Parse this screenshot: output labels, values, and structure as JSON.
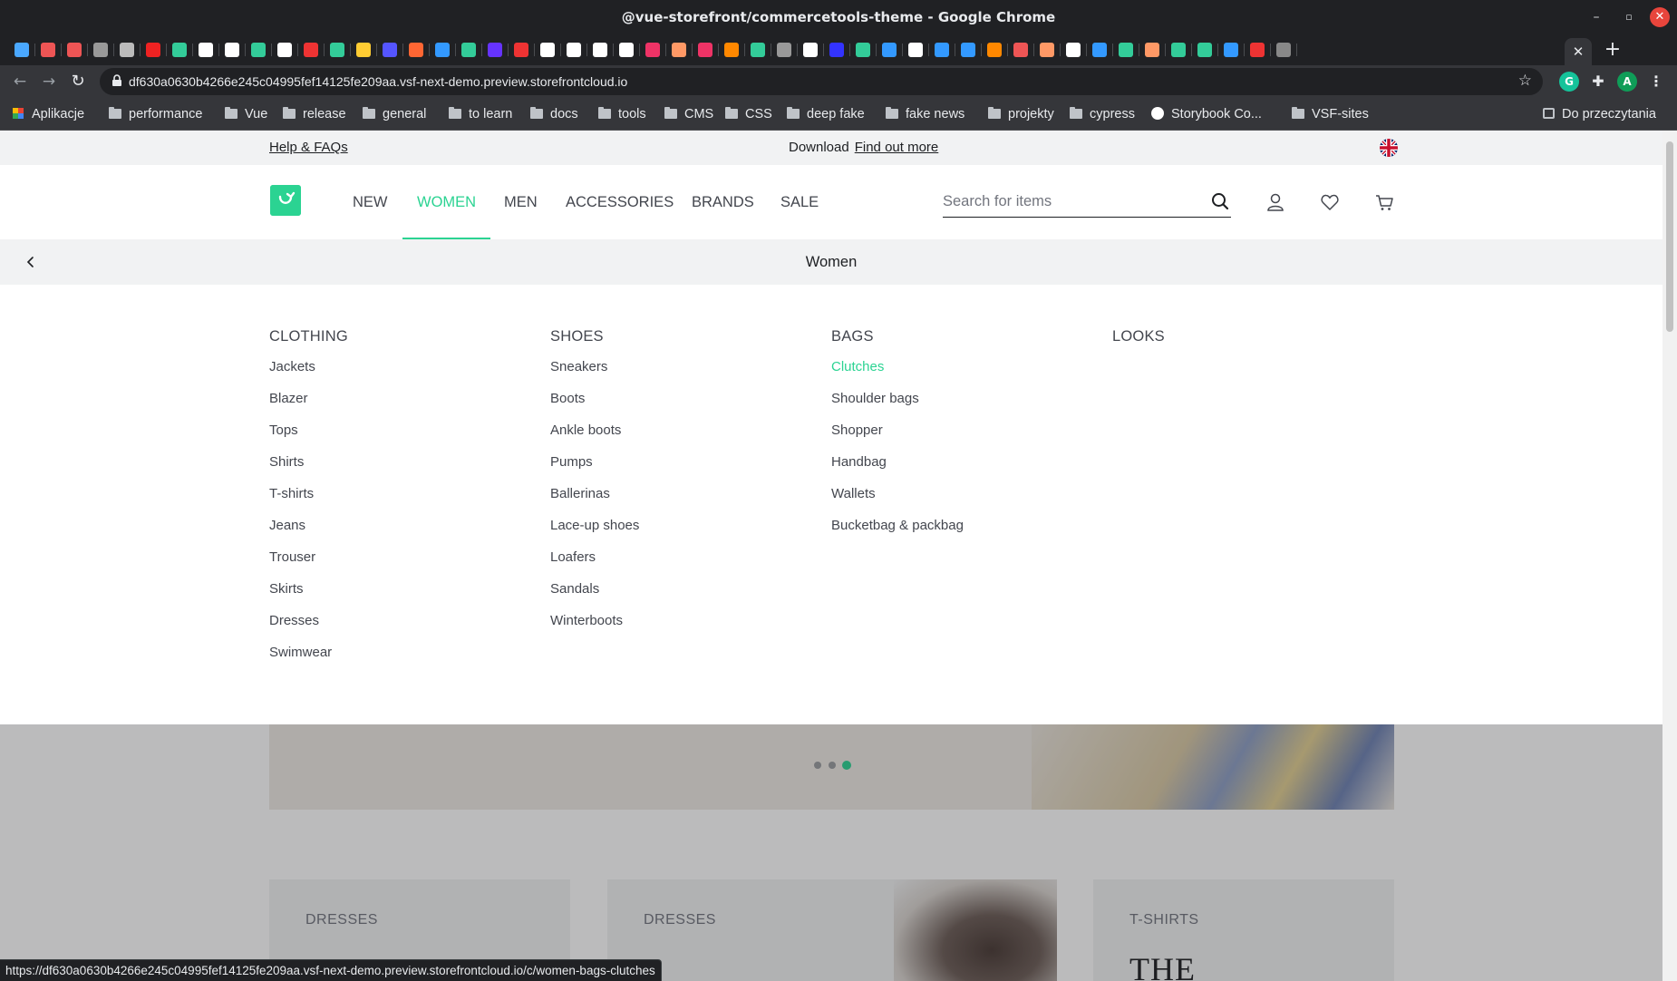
{
  "browser": {
    "window_title": "@vue-storefront/commercetools-theme - Google Chrome",
    "url": "df630a0630b4266e245c04995fef14125fe209aa.vsf-next-demo.preview.storefrontcloud.io",
    "profile_initial": "A",
    "active_tab_close": "✕",
    "new_tab": "+",
    "bookmarks": [
      {
        "label": "Aplikacje",
        "icon": "apps-grid-icon"
      },
      {
        "label": "performance",
        "icon": "folder-icon"
      },
      {
        "label": "Vue",
        "icon": "folder-icon"
      },
      {
        "label": "release",
        "icon": "folder-icon"
      },
      {
        "label": "general",
        "icon": "folder-icon"
      },
      {
        "label": "to learn",
        "icon": "folder-icon"
      },
      {
        "label": "docs",
        "icon": "folder-icon"
      },
      {
        "label": "tools",
        "icon": "folder-icon"
      },
      {
        "label": "CMS",
        "icon": "folder-icon"
      },
      {
        "label": "CSS",
        "icon": "folder-icon"
      },
      {
        "label": "deep fake",
        "icon": "folder-icon"
      },
      {
        "label": "fake news",
        "icon": "folder-icon"
      },
      {
        "label": "projekty",
        "icon": "folder-icon"
      },
      {
        "label": "cypress",
        "icon": "folder-icon"
      },
      {
        "label": "Storybook Co...",
        "icon": "storybook-icon"
      },
      {
        "label": "VSF-sites",
        "icon": "folder-icon"
      }
    ],
    "reading_list": "Do przeczytania",
    "status_url": "https://df630a0630b4266e245c04995fef14125fe209aa.vsf-next-demo.preview.storefrontcloud.io/c/women-bags-clutches"
  },
  "store": {
    "topbar": {
      "help": "Help & FAQs",
      "download": "Download",
      "find_out_more": "Find out more"
    },
    "nav": [
      {
        "label": "NEW",
        "active": false
      },
      {
        "label": "WOMEN",
        "active": true
      },
      {
        "label": "MEN",
        "active": false
      },
      {
        "label": "ACCESSORIES",
        "active": false
      },
      {
        "label": "BRANDS",
        "active": false
      },
      {
        "label": "SALE",
        "active": false
      }
    ],
    "search_placeholder": "Search for items",
    "subheader_title": "Women",
    "megamenu": [
      {
        "heading": "CLOTHING",
        "items": [
          "Jackets",
          "Blazer",
          "Tops",
          "Shirts",
          "T-shirts",
          "Jeans",
          "Trouser",
          "Skirts",
          "Dresses",
          "Swimwear"
        ]
      },
      {
        "heading": "SHOES",
        "items": [
          "Sneakers",
          "Boots",
          "Ankle boots",
          "Pumps",
          "Ballerinas",
          "Lace-up shoes",
          "Loafers",
          "Sandals",
          "Winterboots"
        ]
      },
      {
        "heading": "BAGS",
        "items": [
          "Clutches",
          "Shoulder bags",
          "Shopper",
          "Handbag",
          "Wallets",
          "Bucketbag & packbag"
        ],
        "hovered_item": "Clutches"
      },
      {
        "heading": "LOOKS",
        "items": []
      }
    ],
    "carousel": {
      "dots": 3,
      "active_dot": 3
    },
    "cards": [
      {
        "tag": "DRESSES",
        "big": ""
      },
      {
        "tag": "DRESSES",
        "big": ""
      },
      {
        "tag": "T-SHIRTS",
        "big": "THE"
      }
    ]
  },
  "colors": {
    "primary": "#2bd392",
    "text": "#1d1f22",
    "muted": "#43464e",
    "chrome_dark": "#202124",
    "chrome_toolbar": "#35363a"
  }
}
